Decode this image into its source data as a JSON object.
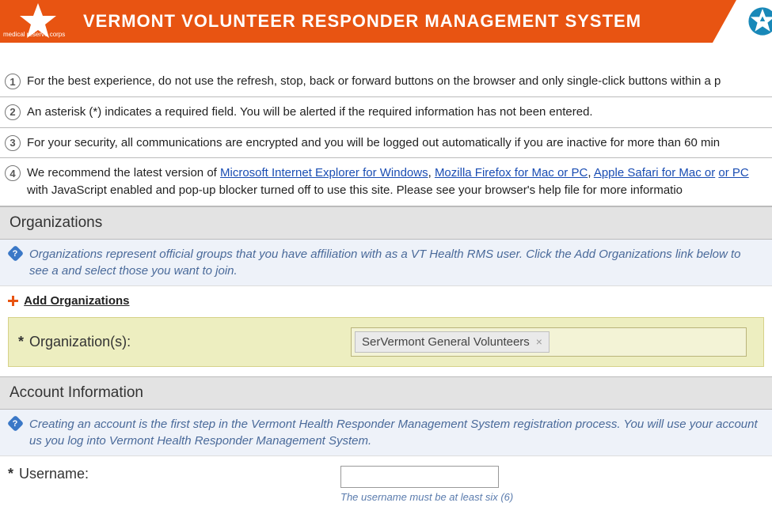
{
  "header": {
    "logo_text": "medical\nreserve\ncorps",
    "title": "VERMONT VOLUNTEER RESPONDER MANAGEMENT SYSTEM"
  },
  "instructions": {
    "n1": "1",
    "t1": "For the best experience, do not use the refresh, stop, back or forward buttons on the browser and only single-click buttons within a p",
    "n2": "2",
    "t2": "An asterisk (*) indicates a required field. You will be alerted if the required information has not been entered.",
    "n3": "3",
    "t3": "For your security, all communications are encrypted and you will be logged out automatically if you are inactive for more than 60 min",
    "n4": "4",
    "t4_pre": "We recommend the latest version of ",
    "t4_link1": "Microsoft Internet Explorer for Windows",
    "t4_sep1": ", ",
    "t4_link2": "Mozilla Firefox for Mac or PC",
    "t4_sep2": ", ",
    "t4_link3": "Apple Safari for Mac or",
    "t4_link4": "or PC",
    "t4_post": " with JavaScript enabled and pop-up blocker turned off to use this site. Please see your browser's help file for more informatio"
  },
  "organizations": {
    "heading": "Organizations",
    "info": "Organizations represent official groups that you have affiliation with as a VT Health RMS user. Click the Add Organizations link below to see a and select those you want to join.",
    "add_link": "Add Organizations",
    "field_label": "Organization(s):",
    "chip": "SerVermont General Volunteers"
  },
  "account": {
    "heading": "Account Information",
    "info": "Creating an account is the first step in the Vermont Health Responder Management System registration process. You will use your account us you log into Vermont Health Responder Management System.",
    "username_label": "Username:",
    "username_hint": "The username must be at least six (6)"
  }
}
